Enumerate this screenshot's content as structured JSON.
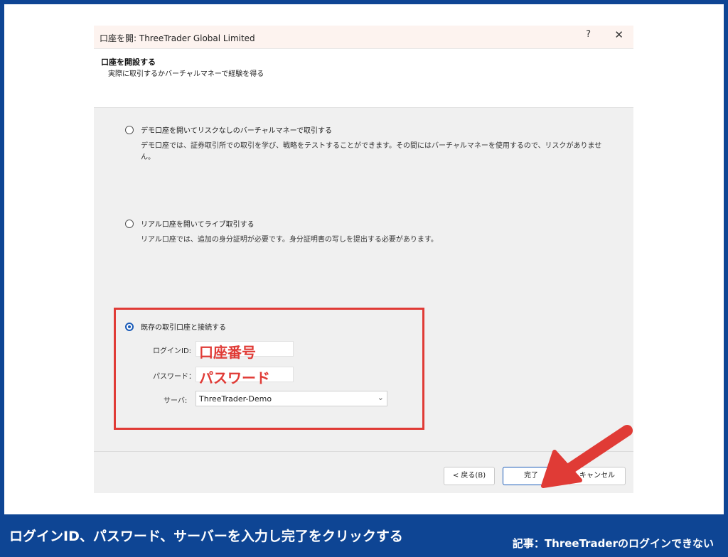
{
  "window": {
    "title": "口座を開: ThreeTrader Global Limited",
    "help_label": "?",
    "close_label": "✕"
  },
  "header": {
    "title": "口座を開設する",
    "subtitle": "実際に取引するかバーチャルマネーで経験を得る"
  },
  "options": [
    {
      "label": "デモ口座を開いてリスクなしのバーチャルマネーで取引する",
      "description": "デモ口座では、証券取引所での取引を学び、戦略をテストすることができます。その間にはバーチャルマネーを使用するので、リスクがありません。",
      "selected": false
    },
    {
      "label": "リアル口座を開いてライブ取引する",
      "description": "リアル口座では、追加の身分証明が必要です。身分証明書の写しを提出する必要があります。",
      "selected": false
    },
    {
      "label": "既存の取引口座と接続する",
      "selected": true
    }
  ],
  "fields": {
    "login_label": "ログインID:",
    "login_overlay": "口座番号",
    "password_label": "パスワード：",
    "password_overlay": "パスワード",
    "server_label": "サーバ:",
    "server_value": "ThreeTrader-Demo"
  },
  "buttons": {
    "back_label": "< 戻る(B)",
    "finish_label": "完了",
    "cancel_label": "キャンセル"
  },
  "caption": {
    "main": "ログインID、パスワード、サーバーを入力し完了をクリックする",
    "article": "記事：ThreeTraderのログインできない"
  },
  "colors": {
    "frame_blue": "#0e4594",
    "highlight_red": "#e03b36",
    "selected_blue": "#1a5bb8"
  },
  "icons": {
    "annotation_arrow": "arrow-pointing-to-finish",
    "server_dropdown": "chevron-down-icon"
  }
}
